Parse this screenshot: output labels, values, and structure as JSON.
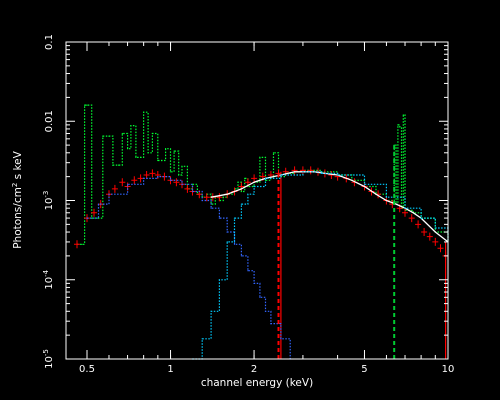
{
  "chart_data": {
    "type": "line",
    "title": "",
    "xlabel": "channel energy (keV)",
    "ylabel_main": "Photons/cm",
    "ylabel_sup": "2",
    "ylabel_rest": " s keV",
    "x_scale": "log",
    "y_scale": "log",
    "xlim": [
      0.42,
      10
    ],
    "ylim": [
      1e-05,
      0.1
    ],
    "grid": false,
    "background": "#000000",
    "axis_color": "#ffffff",
    "x_ticks": [
      {
        "value": 0.5,
        "label": "0.5"
      },
      {
        "value": 1,
        "label": "1"
      },
      {
        "value": 2,
        "label": "2"
      },
      {
        "value": 5,
        "label": "5"
      },
      {
        "value": 10,
        "label": "10"
      }
    ],
    "y_ticks": [
      {
        "value": 0.1,
        "base": "0.1",
        "exp": ""
      },
      {
        "value": 0.01,
        "base": "0.01",
        "exp": ""
      },
      {
        "value": 0.001,
        "base": "10",
        "exp": "-3"
      },
      {
        "value": 0.0001,
        "base": "10",
        "exp": "-4"
      },
      {
        "value": 1e-05,
        "base": "10",
        "exp": "-5"
      }
    ],
    "series": [
      {
        "color": "#00ff33",
        "style": "dotted-step",
        "x": [
          0.46,
          0.48,
          0.49,
          0.5,
          0.52,
          0.55,
          0.57,
          0.6,
          0.62,
          0.65,
          0.67,
          0.7,
          0.72,
          0.75,
          0.78,
          0.8,
          0.83,
          0.86,
          0.9,
          0.93,
          0.96,
          1.0,
          1.03,
          1.07,
          1.1,
          1.15,
          1.2,
          1.25,
          1.3,
          1.35,
          1.4,
          1.45,
          1.5,
          1.55,
          1.6,
          1.7,
          1.75,
          1.8,
          1.85,
          1.9,
          2.0,
          2.1,
          2.2,
          2.3,
          2.35,
          2.45,
          2.6,
          2.8,
          3.0,
          3.2,
          3.5,
          4.0,
          4.5,
          5.0,
          5.5,
          6.0,
          6.3,
          6.4,
          6.5,
          6.6,
          6.7,
          6.8,
          6.9,
          7.0,
          7.5,
          8.0,
          9.0,
          10.0
        ],
        "y": [
          0.00028,
          0.00028,
          0.016,
          0.016,
          0.0006,
          0.0006,
          0.0065,
          0.0065,
          0.0028,
          0.0028,
          0.007,
          0.0045,
          0.0088,
          0.0035,
          0.0035,
          0.013,
          0.004,
          0.007,
          0.0032,
          0.0032,
          0.0045,
          0.0023,
          0.0042,
          0.0021,
          0.0027,
          0.0014,
          0.0016,
          0.0012,
          0.0011,
          0.0012,
          0.0009,
          0.0011,
          0.001,
          0.0011,
          0.0012,
          0.0014,
          0.0017,
          0.0013,
          0.0019,
          0.0015,
          0.0017,
          0.0035,
          0.0018,
          0.0019,
          0.004,
          0.002,
          0.0022,
          0.0023,
          0.0024,
          0.0024,
          0.0023,
          0.0021,
          0.0018,
          0.0015,
          0.0012,
          0.001,
          0.00095,
          0.005,
          0.0009,
          0.009,
          0.0085,
          0.0008,
          0.012,
          0.00075,
          0.0007,
          0.0006,
          0.0004,
          0.0003
        ]
      },
      {
        "color": "#ff0000",
        "style": "crosses",
        "x": [
          0.46,
          0.5,
          0.53,
          0.56,
          0.6,
          0.63,
          0.67,
          0.7,
          0.74,
          0.78,
          0.82,
          0.86,
          0.9,
          0.95,
          1.0,
          1.05,
          1.1,
          1.15,
          1.2,
          1.27,
          1.35,
          1.42,
          1.5,
          1.6,
          1.7,
          1.8,
          1.9,
          2.0,
          2.15,
          2.3,
          2.45,
          2.6,
          2.8,
          3.0,
          3.2,
          3.4,
          3.6,
          3.8,
          4.0,
          4.3,
          4.6,
          5.0,
          5.3,
          5.6,
          6.0,
          6.3,
          6.7,
          7.0,
          7.4,
          7.8,
          8.2,
          8.6,
          9.0,
          9.4,
          9.8
        ],
        "y": [
          0.00028,
          0.0006,
          0.0007,
          0.0009,
          0.0012,
          0.0014,
          0.0017,
          0.0015,
          0.0018,
          0.0019,
          0.0021,
          0.0022,
          0.0021,
          0.002,
          0.0018,
          0.0017,
          0.0016,
          0.0014,
          0.0013,
          0.0012,
          0.0011,
          0.0011,
          0.0011,
          0.0012,
          0.0013,
          0.0015,
          0.0017,
          0.0019,
          0.002,
          0.0021,
          0.0022,
          0.0023,
          0.0024,
          0.0024,
          0.0024,
          0.0023,
          0.0022,
          0.0021,
          0.002,
          0.0019,
          0.0017,
          0.0015,
          0.0013,
          0.0012,
          0.001,
          0.0009,
          0.0008,
          0.0007,
          0.0006,
          0.0005,
          0.0004,
          0.00035,
          0.0003,
          0.00025,
          0.0002
        ],
        "drops_x": [
          2.5,
          9.8
        ],
        "drops_y": [
          0.0023,
          0.0003
        ]
      },
      {
        "color": "#ffffff",
        "style": "solid",
        "x": [
          1.4,
          1.5,
          1.6,
          1.8,
          2.0,
          2.2,
          2.5,
          2.8,
          3.0,
          3.3,
          3.6,
          4.0,
          4.5,
          5.0,
          5.5,
          6.0,
          6.5,
          7.0,
          7.5,
          8.0,
          9.0,
          10.0
        ],
        "y": [
          0.0011,
          0.00115,
          0.0012,
          0.0014,
          0.0017,
          0.0019,
          0.0021,
          0.0023,
          0.0023,
          0.0023,
          0.0022,
          0.0021,
          0.0018,
          0.0015,
          0.0012,
          0.001,
          0.0009,
          0.0008,
          0.0007,
          0.0006,
          0.0004,
          0.0003
        ]
      },
      {
        "color": "#3366ff",
        "style": "dotted-step",
        "x": [
          0.5,
          0.55,
          0.6,
          0.7,
          0.8,
          0.9,
          1.0,
          1.1,
          1.2,
          1.3,
          1.4,
          1.5,
          1.6,
          1.7,
          1.8,
          1.9,
          2.0,
          2.1,
          2.2,
          2.3,
          2.5,
          2.7
        ],
        "y": [
          0.0006,
          0.0009,
          0.0012,
          0.0016,
          0.0019,
          0.002,
          0.0018,
          0.0016,
          0.0013,
          0.001,
          0.0008,
          0.0006,
          0.0004,
          0.00028,
          0.0002,
          0.00013,
          9e-05,
          6e-05,
          4e-05,
          2.8e-05,
          1.8e-05,
          1e-05
        ]
      },
      {
        "color": "#00ccff",
        "style": "dotted-step",
        "x": [
          1.2,
          1.3,
          1.4,
          1.5,
          1.6,
          1.7,
          1.8,
          1.9,
          2.0,
          2.2,
          2.5,
          3.0,
          3.5,
          4.0,
          5.0,
          6.0,
          7.0,
          8.0,
          9.0,
          10.0
        ],
        "y": [
          1e-05,
          1.8e-05,
          4e-05,
          0.0001,
          0.0003,
          0.0006,
          0.0009,
          0.0012,
          0.0015,
          0.0019,
          0.0021,
          0.0023,
          0.0022,
          0.0021,
          0.0016,
          0.0011,
          0.0008,
          0.0006,
          0.00045,
          0.00032
        ]
      },
      {
        "color": "#ff0000",
        "style": "dashed-vertical",
        "x": [
          2.45,
          2.45
        ],
        "y": [
          1e-05,
          0.0023
        ]
      },
      {
        "color": "#00cc33",
        "style": "dashed-vertical",
        "x": [
          6.4,
          6.4
        ],
        "y": [
          1e-05,
          0.005
        ]
      }
    ]
  }
}
